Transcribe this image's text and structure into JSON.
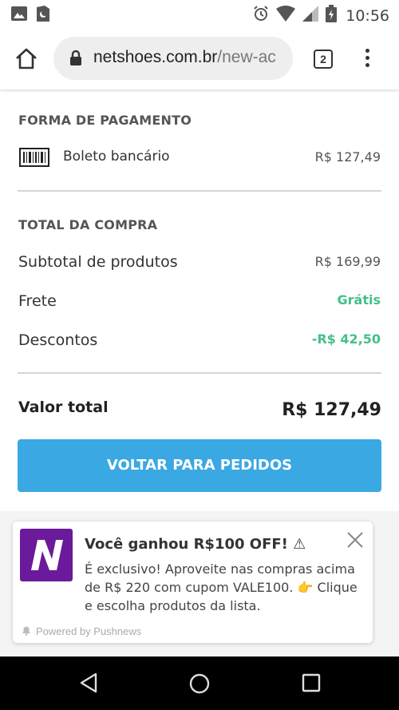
{
  "status_bar": {
    "time": "10:56",
    "left_icons": [
      "image-icon",
      "sim-moon-icon"
    ],
    "right_icons": [
      "alarm-icon",
      "wifi-icon",
      "signal-icon",
      "battery-icon"
    ]
  },
  "browser": {
    "url_domain": "netshoes.com.br",
    "url_path": "/new-ac",
    "tab_count": "2"
  },
  "payment": {
    "section_title": "FORMA DE PAGAMENTO",
    "method_label": "Boleto bancário",
    "method_value": "R$ 127,49"
  },
  "totals": {
    "section_title": "TOTAL DA COMPRA",
    "rows": [
      {
        "label": "Subtotal de produtos",
        "value": "R$ 169,99"
      },
      {
        "label": "Frete",
        "value": "Grátis"
      },
      {
        "label": "Descontos",
        "value": "-R$ 42,50"
      }
    ],
    "total_label": "Valor total",
    "total_value": "R$ 127,49"
  },
  "cta": {
    "label": "VOLTAR PARA PEDIDOS"
  },
  "notification": {
    "title": "Você ganhou R$100 OFF! ⚠",
    "body": "É exclusivo! Aproveite nas compras acima de R$ 220 com cupom VALE100. 👉 Clique e escolha produtos da lista.",
    "footer": "Powered by Pushnews"
  },
  "colors": {
    "accent_blue": "#3aa8e2",
    "green": "#44c08a",
    "brand_purple": "#6a1a9a"
  }
}
